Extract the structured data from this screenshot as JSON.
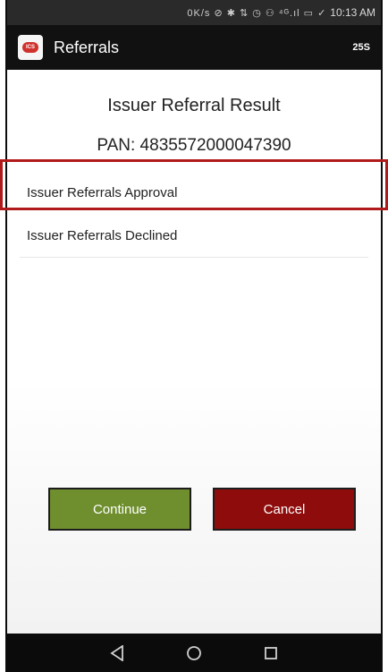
{
  "status_bar": {
    "icons": "0K/s ⊘ ✱ ⇅ ◷ ⚇ ⁴ᴳ.ıl ▭ ✓",
    "time": "10:13 AM"
  },
  "app_bar": {
    "title": "Referrals",
    "timer": "25S",
    "logo_text": "ICS"
  },
  "content": {
    "title": "Issuer Referral Result",
    "pan": "PAN: 4835572000047390",
    "options": [
      {
        "label": "Issuer Referrals Approval",
        "highlighted": true
      },
      {
        "label": "Issuer Referrals Declined",
        "highlighted": false
      }
    ]
  },
  "buttons": {
    "continue_label": "Continue",
    "cancel_label": "Cancel",
    "continue_color": "#6f8f2f",
    "cancel_color": "#8f0c0c"
  },
  "highlight_color": "#b11a1a",
  "nav_bar": {
    "back_icon": "triangle-back-icon",
    "home_icon": "circle-home-icon",
    "recents_icon": "square-recents-icon"
  }
}
